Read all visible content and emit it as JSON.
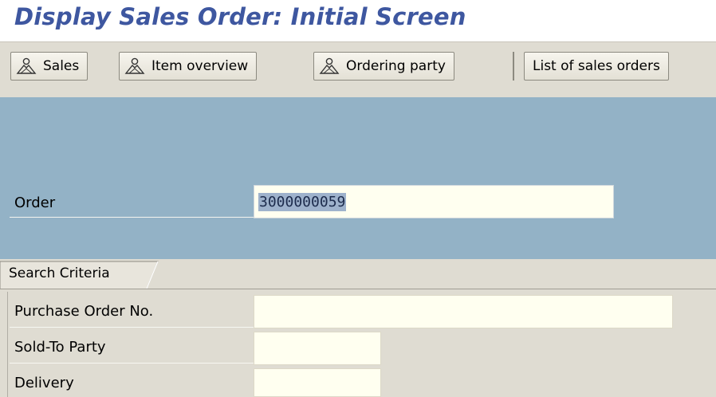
{
  "title": "Display Sales Order: Initial Screen",
  "toolbar": {
    "sales_label": "Sales",
    "item_overview_label": "Item overview",
    "ordering_party_label": "Ordering party",
    "list_label": "List of sales orders"
  },
  "header": {
    "order_label": "Order",
    "order_value": "3000000059"
  },
  "search": {
    "tab_label": "Search Criteria",
    "po_label": "Purchase Order No.",
    "po_value": "",
    "sold_to_label": "Sold-To Party",
    "sold_to_value": "",
    "delivery_label": "Delivery",
    "delivery_value": ""
  },
  "colors": {
    "title": "#3e57a0",
    "blue_panel": "#93b2c6",
    "background": "#dfdcd2",
    "input": "#fffff0"
  }
}
